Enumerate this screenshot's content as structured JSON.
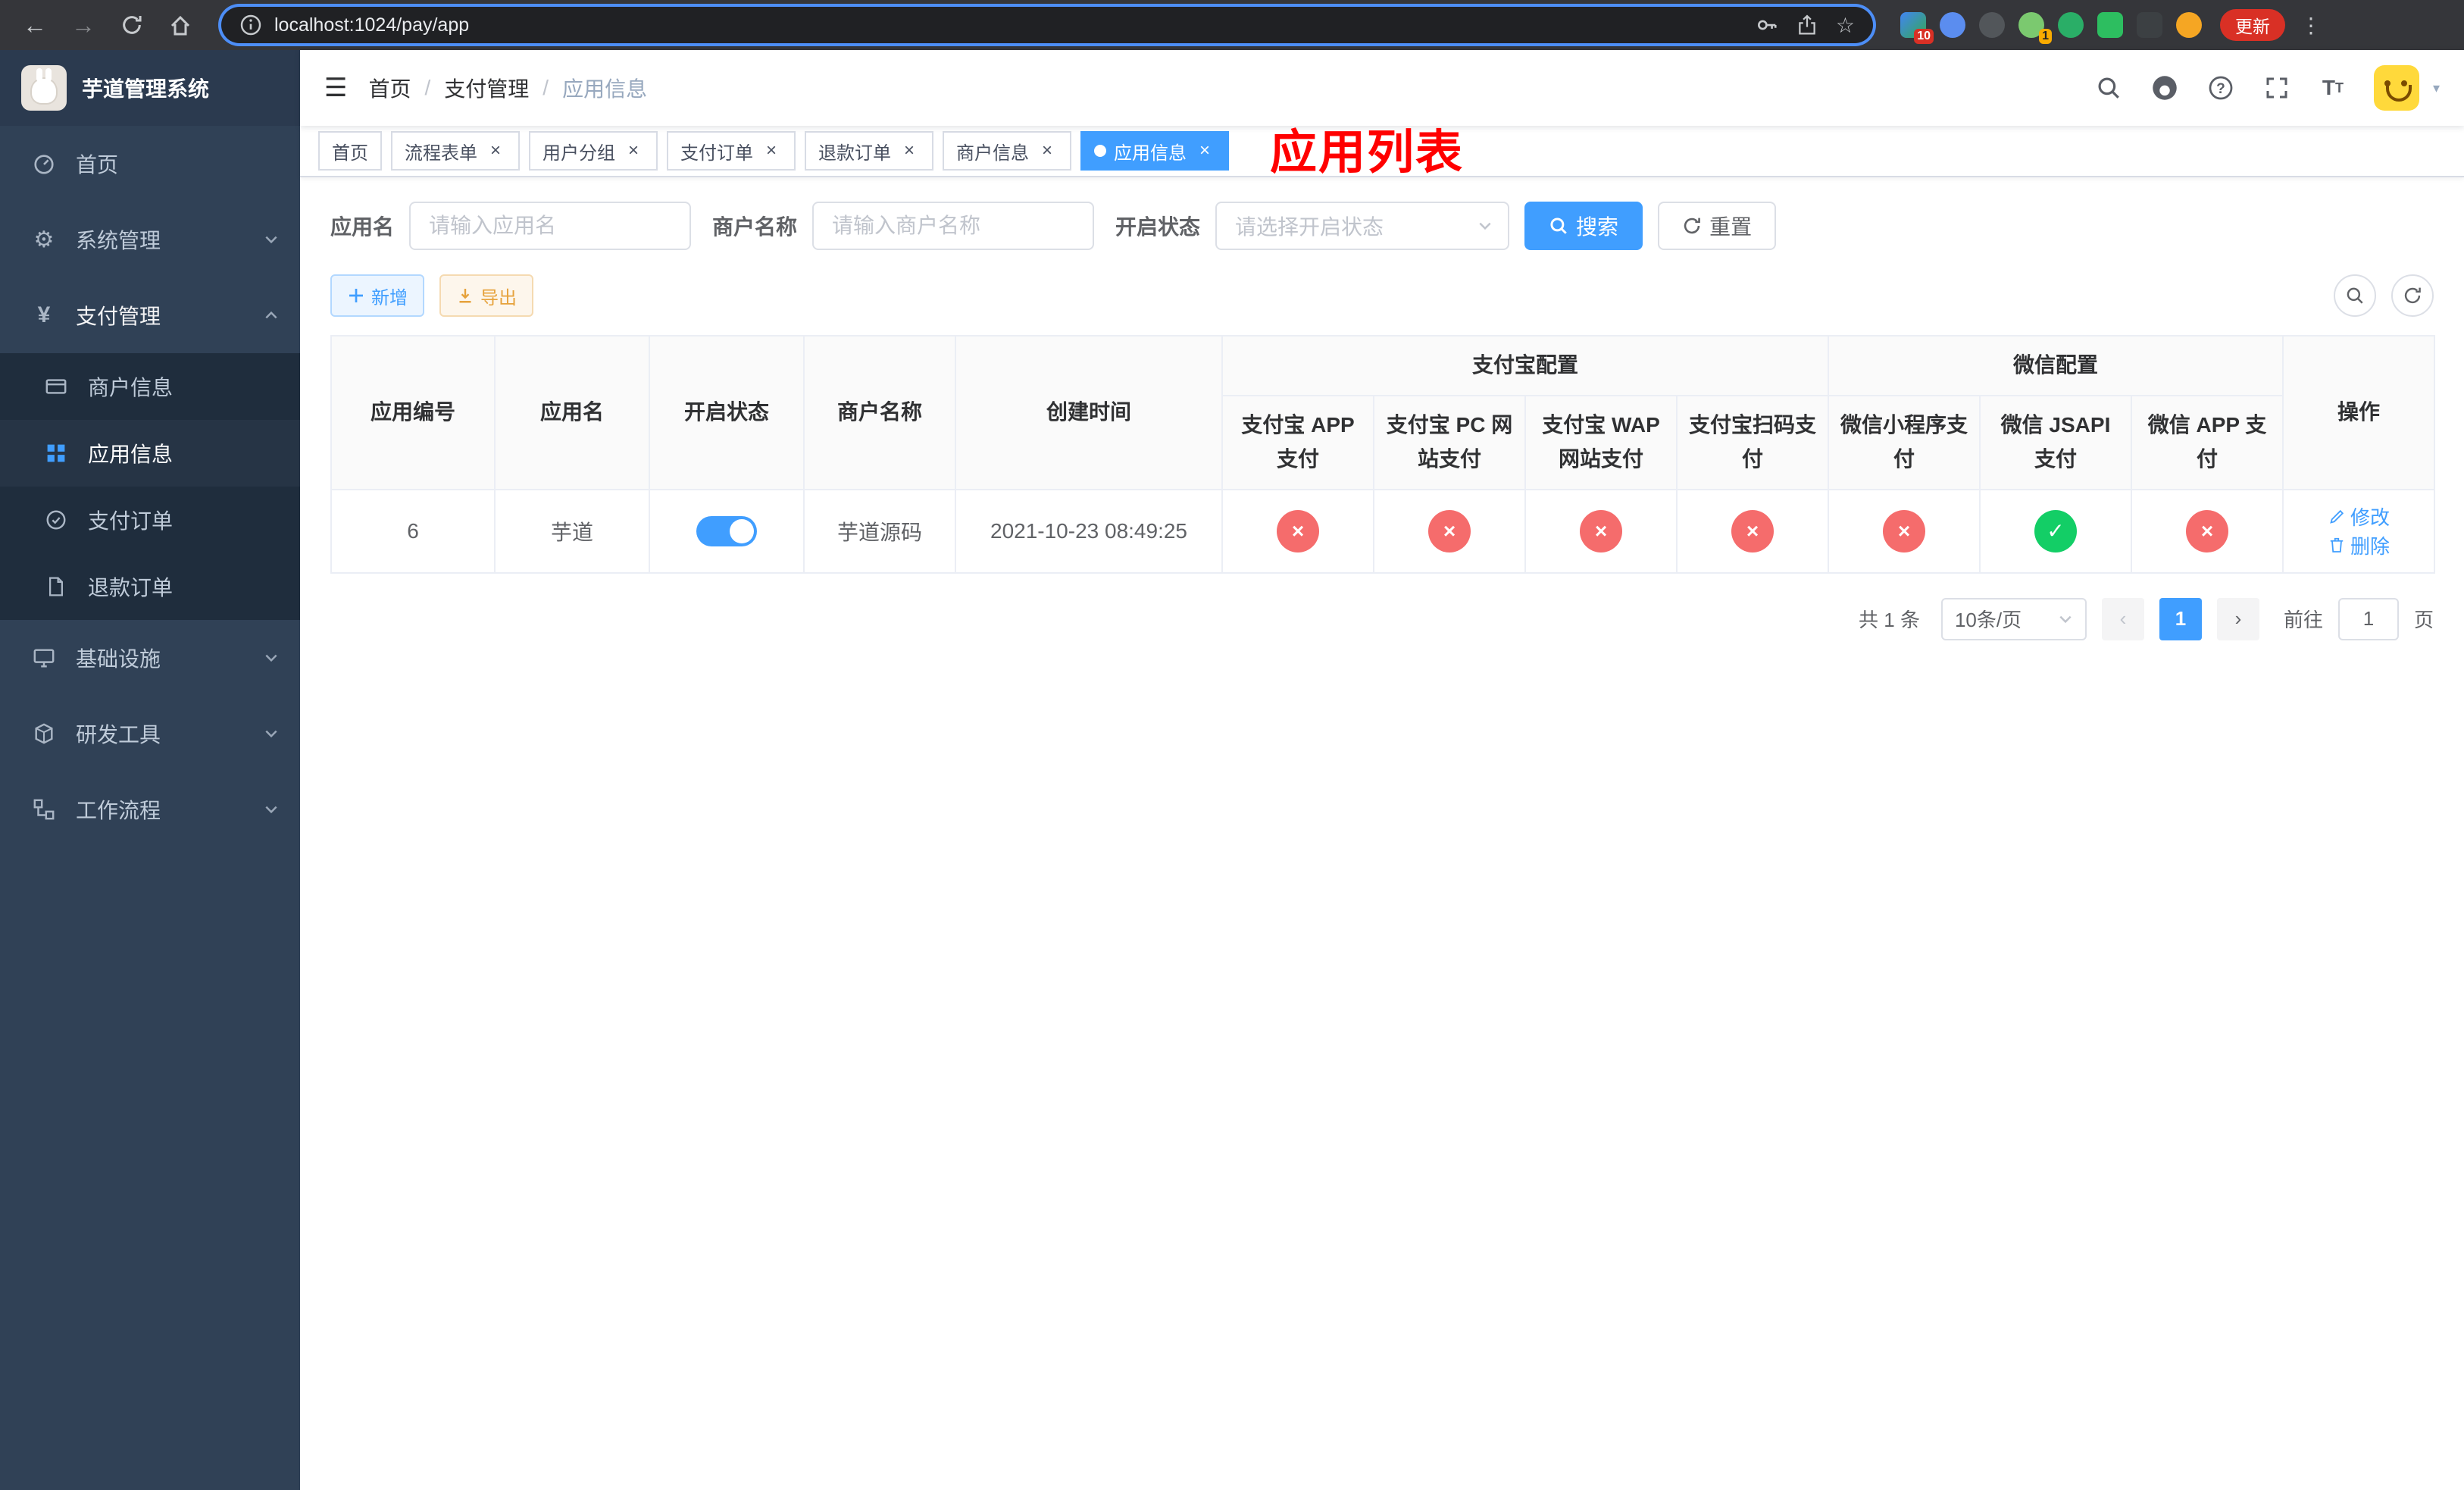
{
  "browser": {
    "url": "localhost:1024/pay/app",
    "update_label": "更新",
    "extensions_badge": "10",
    "wechat_badge": "1"
  },
  "sidebar": {
    "title": "芋道管理系统",
    "items": {
      "home": "首页",
      "system": "系统管理",
      "payment": "支付管理",
      "infra": "基础设施",
      "devtools": "研发工具",
      "workflow": "工作流程"
    },
    "payment_children": {
      "merchant": "商户信息",
      "app": "应用信息",
      "pay_order": "支付订单",
      "refund_order": "退款订单"
    }
  },
  "header": {
    "breadcrumb": [
      "首页",
      "支付管理",
      "应用信息"
    ],
    "title": "应用列表"
  },
  "tabs": [
    {
      "label": "首页"
    },
    {
      "label": "流程表单"
    },
    {
      "label": "用户分组"
    },
    {
      "label": "支付订单"
    },
    {
      "label": "退款订单"
    },
    {
      "label": "商户信息"
    },
    {
      "label": "应用信息"
    }
  ],
  "filters": {
    "app_name_label": "应用名",
    "app_name_placeholder": "请输入应用名",
    "merchant_label": "商户名称",
    "merchant_placeholder": "请输入商户名称",
    "status_label": "开启状态",
    "status_placeholder": "请选择开启状态",
    "search_label": "搜索",
    "reset_label": "重置"
  },
  "toolbar": {
    "add_label": "新增",
    "export_label": "导出"
  },
  "table": {
    "simple_columns": [
      "应用编号",
      "应用名",
      "开启状态",
      "商户名称",
      "创建时间"
    ],
    "groups": [
      {
        "label": "支付宝配置",
        "columns": [
          "支付宝 APP 支付",
          "支付宝 PC 网站支付",
          "支付宝 WAP 网站支付",
          "支付宝扫码支付"
        ]
      },
      {
        "label": "微信配置",
        "columns": [
          "微信小程序支付",
          "微信 JSAPI 支付",
          "微信 APP 支付"
        ]
      }
    ],
    "action_column": "操作",
    "rows": [
      {
        "id": "6",
        "app_name": "芋道",
        "enabled": true,
        "merchant": "芋道源码",
        "created_at": "2021-10-23 08:49:25",
        "alipay_app": false,
        "alipay_pc": false,
        "alipay_wap": false,
        "alipay_qr": false,
        "wechat_mini": false,
        "wechat_jsapi": true,
        "wechat_app": false,
        "actions": [
          "修改",
          "删除"
        ]
      }
    ]
  },
  "pagination": {
    "total": "共 1 条",
    "page_size": "10条/页",
    "current_page": "1",
    "goto_label": "前往",
    "goto_value": "1",
    "page_unit": "页"
  }
}
